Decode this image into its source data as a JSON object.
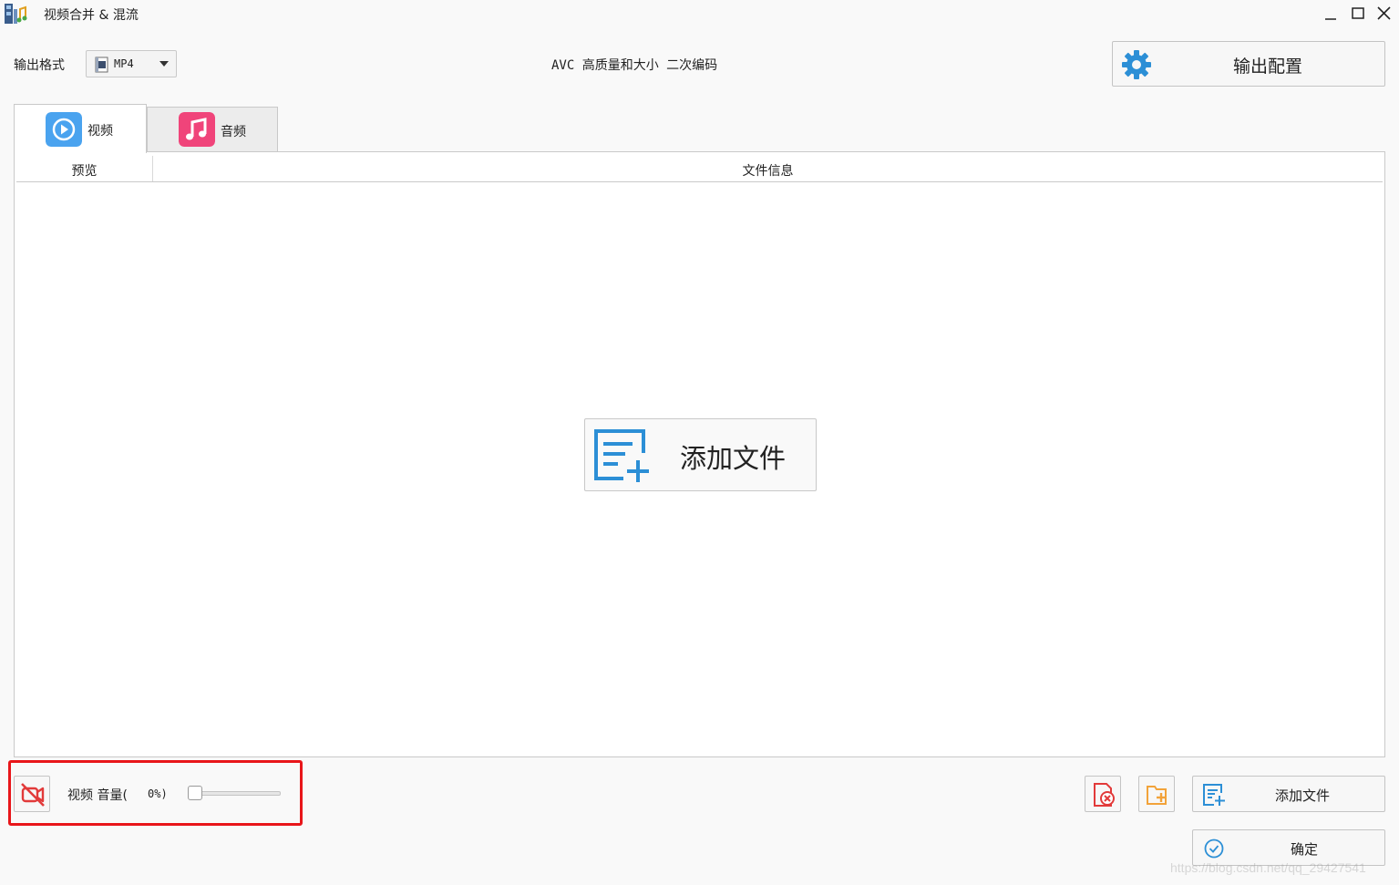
{
  "window": {
    "title": "视频合并 & 混流"
  },
  "format": {
    "label": "输出格式",
    "selected": "MP4"
  },
  "encode_info": "AVC 高质量和大小 二次编码",
  "output_config_label": "输出配置",
  "tabs": [
    {
      "label": "视频",
      "icon": "play-circle-icon",
      "color": "#4aa3ef",
      "active": true
    },
    {
      "label": "音频",
      "icon": "music-note-icon",
      "color": "#f0447a",
      "active": false
    }
  ],
  "table": {
    "columns": [
      "预览",
      "文件信息"
    ]
  },
  "add_file_big_label": "添加文件",
  "bottom": {
    "track_label": "视频",
    "volume_label": "音量(",
    "volume_value": "0%)",
    "volume_level": 0,
    "add_file_label": "添加文件",
    "confirm_label": "确定"
  },
  "watermark": "https://blog.csdn.net/qq_29427541",
  "colors": {
    "accent_blue": "#2c8fd6",
    "highlight_red": "#e8161a",
    "folder_orange": "#f2a33a"
  }
}
